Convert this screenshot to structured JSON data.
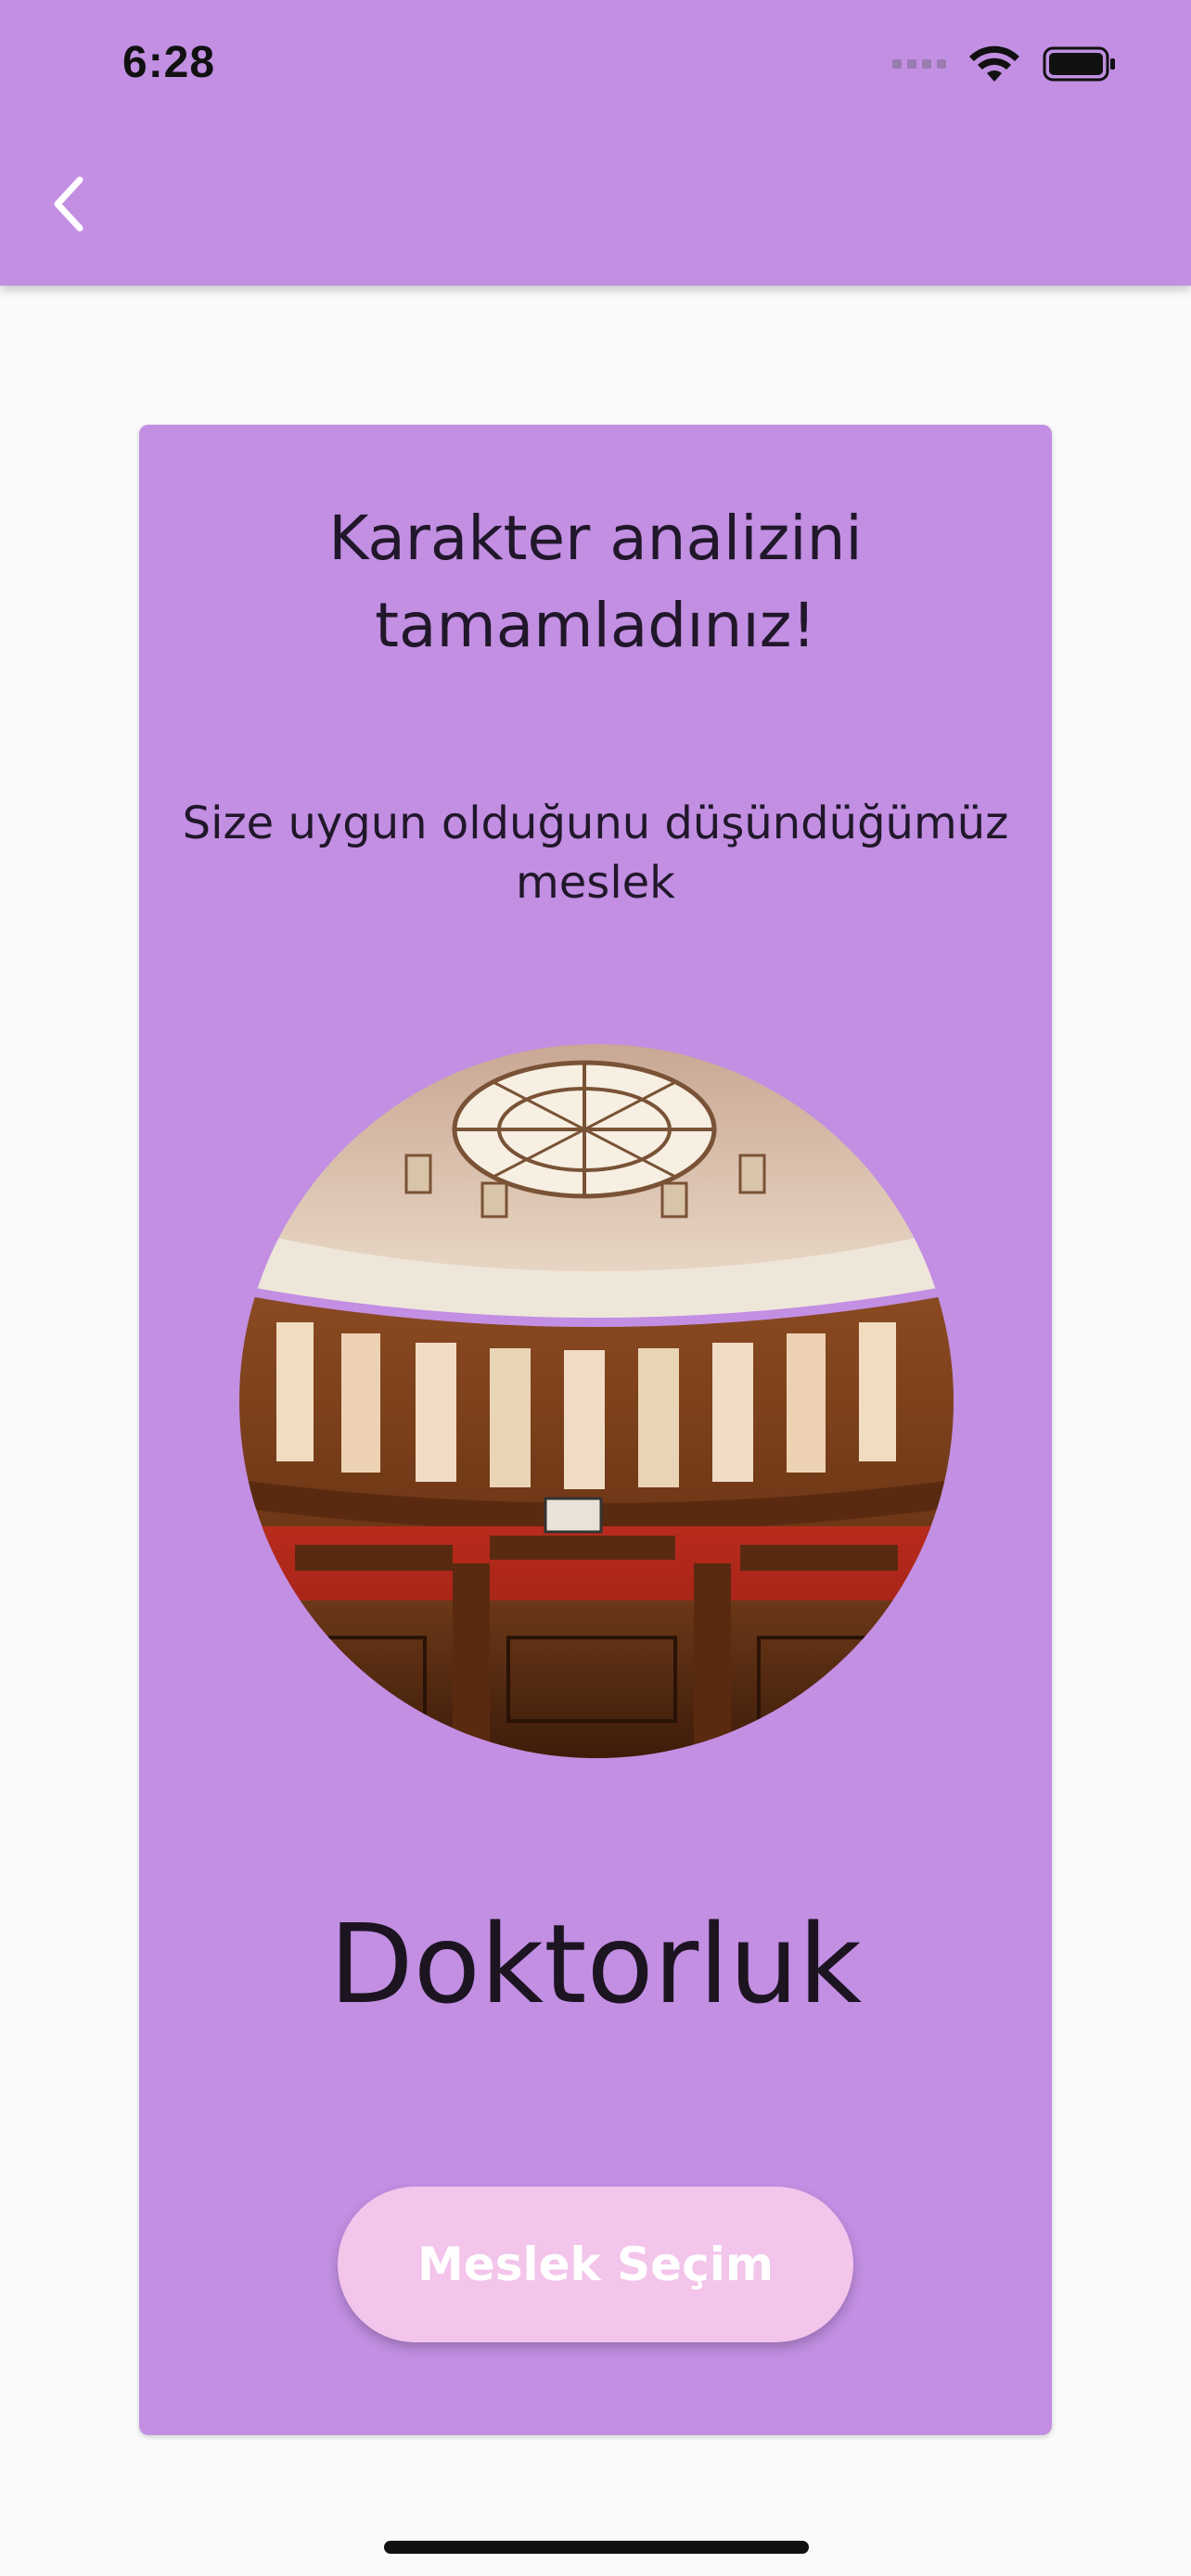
{
  "status_bar": {
    "time": "6:28",
    "icons": [
      "cellular-signal-icon",
      "wifi-icon",
      "battery-icon"
    ]
  },
  "app_bar": {
    "back_icon": "chevron-left-icon",
    "background_color": "#c28fe3"
  },
  "result_card": {
    "title": "Karakter analizini\ntamamladınız!",
    "subtitle": "Size uygun olduğunu düşündüğümüz\nmeslek",
    "image": "courtroom-photo",
    "profession": "Doktorluk",
    "button_label": "Meslek Seçim",
    "card_color": "#c28fe3",
    "button_color": "#f3c5eb"
  }
}
